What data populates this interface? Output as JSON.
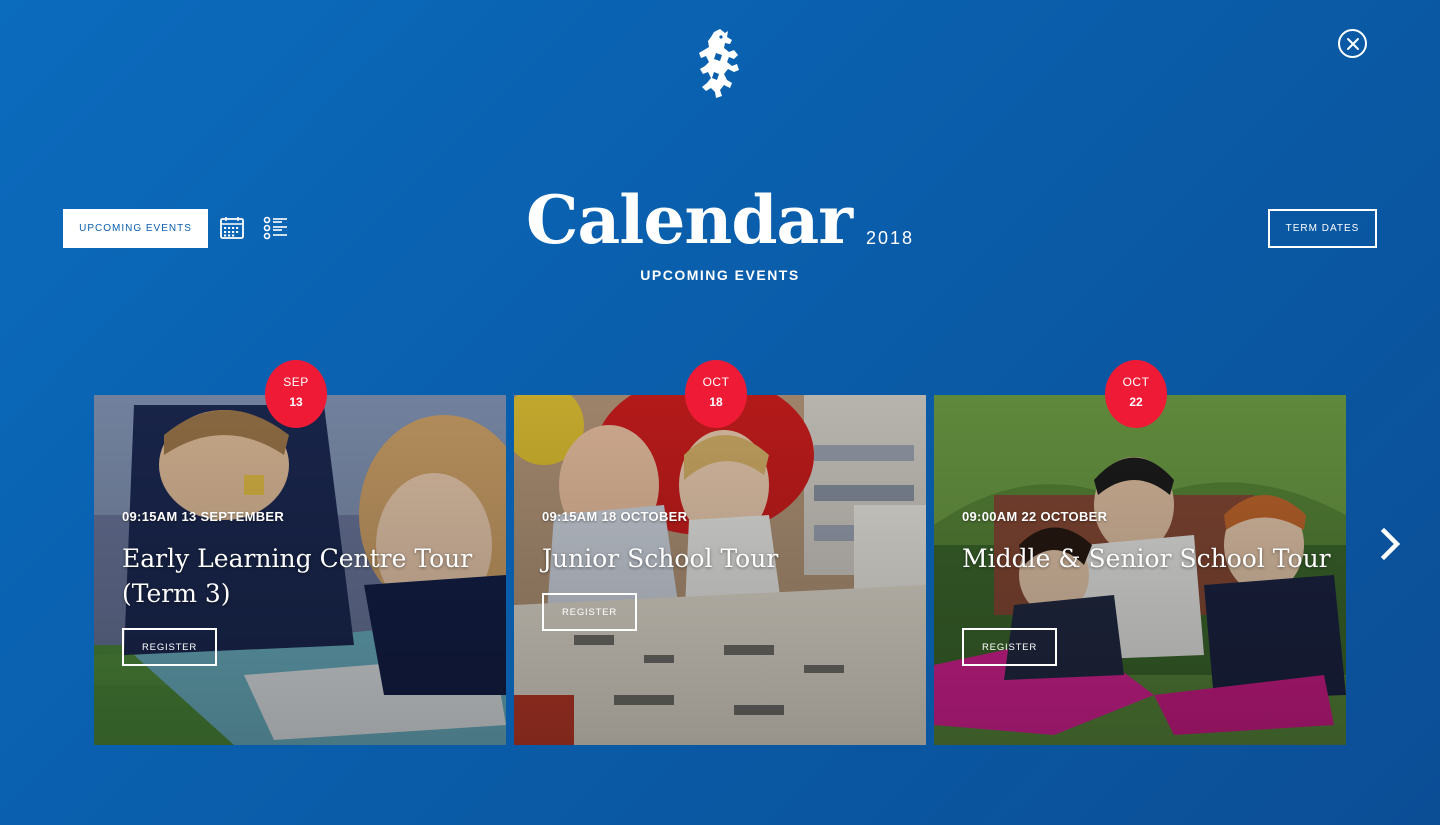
{
  "header": {
    "logo_icon": "lion-rampant-crest-icon",
    "close_icon": "close-icon"
  },
  "controls": {
    "upcoming_events_label": "UPCOMING EVENTS",
    "calendar_view_icon": "calendar-grid-icon",
    "list_view_icon": "list-view-icon",
    "term_dates_label": "TERM DATES"
  },
  "title": {
    "main": "Calendar",
    "year": "2018",
    "subtitle": "UPCOMING EVENTS"
  },
  "events": [
    {
      "month": "SEP",
      "day": "13",
      "time": "09:15AM 13 SEPTEMBER",
      "title": "Early Learning Centre Tour (Term 3)",
      "button": "REGISTER"
    },
    {
      "month": "OCT",
      "day": "18",
      "time": "09:15AM 18 OCTOBER",
      "title": "Junior School Tour",
      "button": "REGISTER"
    },
    {
      "month": "OCT",
      "day": "22",
      "time": "09:00AM 22 OCTOBER",
      "title": "Middle & Senior School Tour",
      "button": "REGISTER"
    }
  ],
  "navigation": {
    "next_icon": "chevron-right-icon"
  },
  "colors": {
    "background": "#0a5eab",
    "badge": "#ef1b36",
    "text": "#ffffff"
  }
}
